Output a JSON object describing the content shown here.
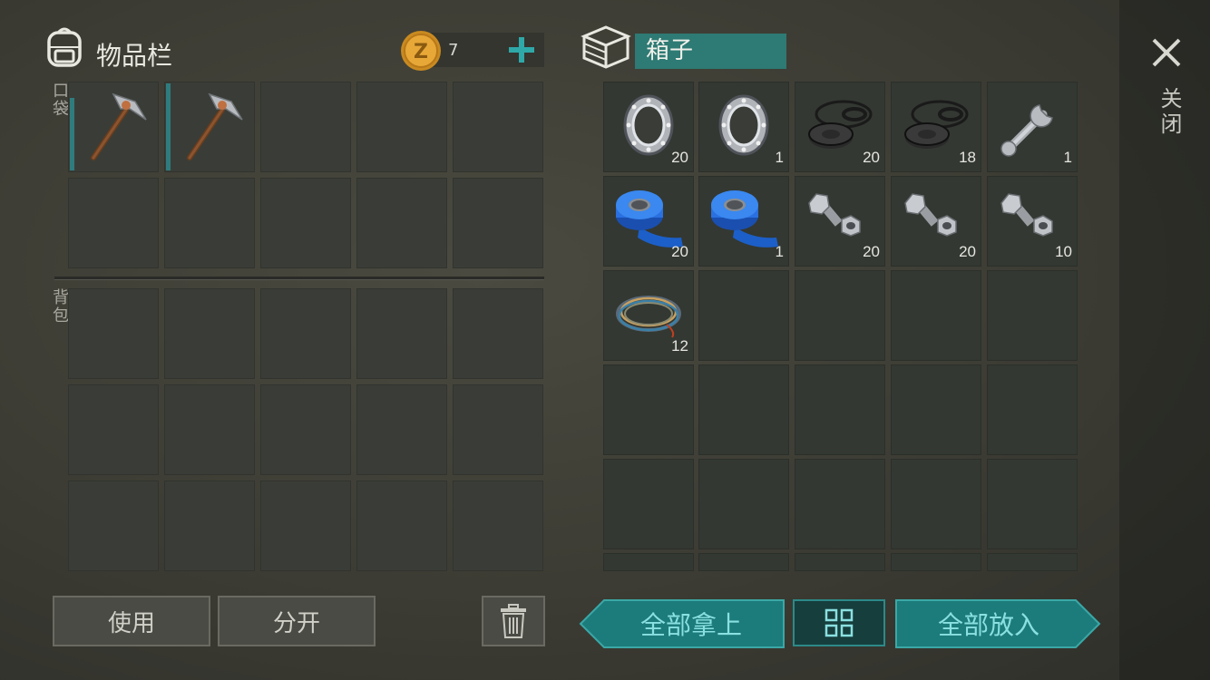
{
  "inventory": {
    "title": "物品栏",
    "pocket_label": "口袋",
    "backpack_label": "背包",
    "currency_amount": "7",
    "pocket_items": [
      {
        "icon": "pickaxe-icon",
        "count": ""
      },
      {
        "icon": "pickaxe-icon",
        "count": ""
      }
    ]
  },
  "container": {
    "title": "箱子",
    "items": [
      {
        "icon": "bearing-icon",
        "count": "20"
      },
      {
        "icon": "bearing-icon",
        "count": "1"
      },
      {
        "icon": "rubber-seal-icon",
        "count": "20"
      },
      {
        "icon": "rubber-seal-icon",
        "count": "18"
      },
      {
        "icon": "wrench-icon",
        "count": "1"
      },
      {
        "icon": "blue-tape-icon",
        "count": "20"
      },
      {
        "icon": "blue-tape-icon",
        "count": "1"
      },
      {
        "icon": "bolt-nut-icon",
        "count": "20"
      },
      {
        "icon": "bolt-nut-icon",
        "count": "20"
      },
      {
        "icon": "bolt-nut-icon",
        "count": "10"
      },
      {
        "icon": "wire-coil-icon",
        "count": "12"
      }
    ]
  },
  "close_label": "关闭",
  "buttons": {
    "use": "使用",
    "split": "分开",
    "take_all": "全部拿上",
    "put_all": "全部放入"
  },
  "colors": {
    "accent_teal": "#1f7f80",
    "teal_text": "#8ae0e0",
    "coin_gold": "#e0a030"
  }
}
